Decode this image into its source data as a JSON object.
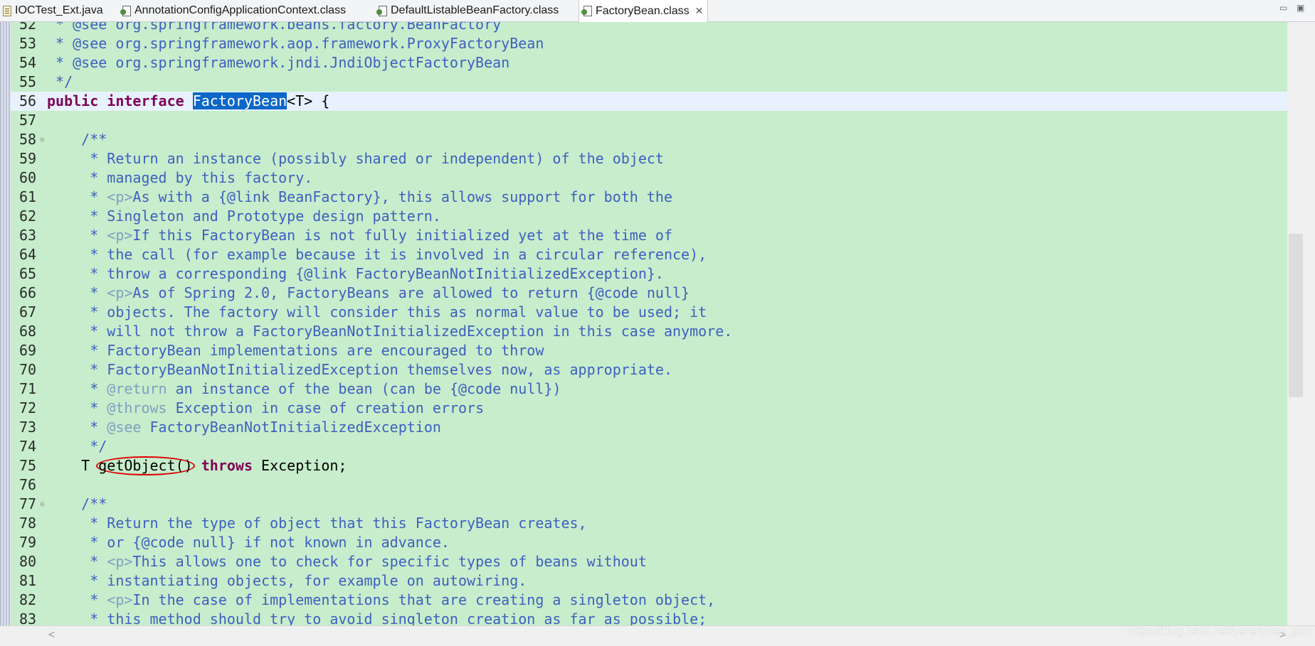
{
  "tabs": [
    {
      "label": "IOCTest_Ext.java",
      "icon": "java-file-icon"
    },
    {
      "label": "AnnotationConfigApplicationContext.class",
      "icon": "class-file-icon"
    },
    {
      "label": "DefaultListableBeanFactory.class",
      "icon": "class-file-icon"
    },
    {
      "label": "FactoryBean.class",
      "icon": "class-file-icon",
      "active": true,
      "close": "✕"
    }
  ],
  "window_controls": {
    "minimize": "▭",
    "maximize": "▣"
  },
  "editor": {
    "lines": [
      {
        "n": "52",
        "text": " * @see org.springframework.beans.factory.BeanFactory"
      },
      {
        "n": "53",
        "text": " * @see org.springframework.aop.framework.ProxyFactoryBean"
      },
      {
        "n": "54",
        "text": " * @see org.springframework.jndi.JndiObjectFactoryBean"
      },
      {
        "n": "55",
        "text": " */"
      },
      {
        "n": "56",
        "kw1": "public interface ",
        "sel": "FactoryBean",
        "rest": "<T> {"
      },
      {
        "n": "57",
        "text": ""
      },
      {
        "n": "58",
        "text": "    /**",
        "fold": "⊖"
      },
      {
        "n": "59",
        "text": "     * Return an instance (possibly shared or independent) of the object"
      },
      {
        "n": "60",
        "text": "     * managed by this factory."
      },
      {
        "n": "61",
        "pre": "     * ",
        "tag": "<p>",
        "post": "As with a {@link BeanFactory}, this allows support for both the"
      },
      {
        "n": "62",
        "text": "     * Singleton and Prototype design pattern."
      },
      {
        "n": "63",
        "pre": "     * ",
        "tag": "<p>",
        "post": "If this FactoryBean is not fully initialized yet at the time of"
      },
      {
        "n": "64",
        "text": "     * the call (for example because it is involved in a circular reference),"
      },
      {
        "n": "65",
        "text": "     * throw a corresponding {@link FactoryBeanNotInitializedException}."
      },
      {
        "n": "66",
        "pre": "     * ",
        "tag": "<p>",
        "post": "As of Spring 2.0, FactoryBeans are allowed to return {@code null}"
      },
      {
        "n": "67",
        "text": "     * objects. The factory will consider this as normal value to be used; it"
      },
      {
        "n": "68",
        "text": "     * will not throw a FactoryBeanNotInitializedException in this case anymore."
      },
      {
        "n": "69",
        "text": "     * FactoryBean implementations are encouraged to throw"
      },
      {
        "n": "70",
        "text": "     * FactoryBeanNotInitializedException themselves now, as appropriate."
      },
      {
        "n": "71",
        "pre": "     * ",
        "tag": "@return",
        "post": " an instance of the bean (can be {@code null})"
      },
      {
        "n": "72",
        "pre": "     * ",
        "tag": "@throws",
        "post": " Exception in case of creation errors"
      },
      {
        "n": "73",
        "pre": "     * ",
        "tag": "@see",
        "post": " FactoryBeanNotInitializedException"
      },
      {
        "n": "74",
        "text": "     */"
      },
      {
        "n": "75",
        "pre": "    T ",
        "circled": "getObject()",
        "kw": " throws",
        "post": " Exception;"
      },
      {
        "n": "76",
        "text": ""
      },
      {
        "n": "77",
        "text": "    /**",
        "fold": "⊖"
      },
      {
        "n": "78",
        "text": "     * Return the type of object that this FactoryBean creates,"
      },
      {
        "n": "79",
        "text": "     * or {@code null} if not known in advance."
      },
      {
        "n": "80",
        "pre": "     * ",
        "tag": "<p>",
        "post": "This allows one to check for specific types of beans without"
      },
      {
        "n": "81",
        "text": "     * instantiating objects, for example on autowiring."
      },
      {
        "n": "82",
        "pre": "     * ",
        "tag": "<p>",
        "post": "In the case of implementations that are creating a singleton object,"
      },
      {
        "n": "83",
        "text": "     * this method should try to avoid singleton creation as far as possible;"
      }
    ]
  },
  "watermark": "https://blog.csdn.net/yerenyuan_pku",
  "scroll_arrows": {
    "left": "<",
    "right": ">"
  },
  "colors": {
    "editor_bg": "#c7edcc",
    "comment": "#3f5fbf",
    "keyword": "#7f0055",
    "selection": "#0b67c8",
    "annotation_circle": "#e10000"
  }
}
